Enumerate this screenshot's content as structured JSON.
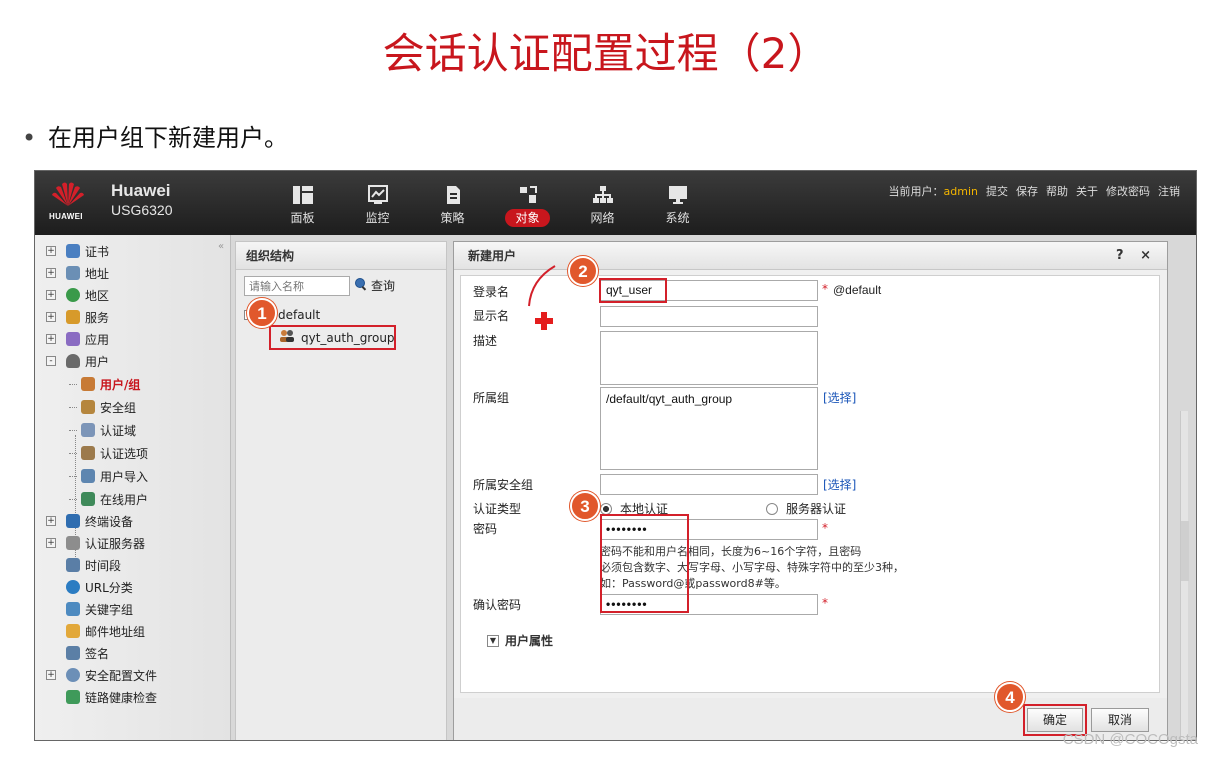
{
  "slide": {
    "title": "会话认证配置过程（2）",
    "bullet": "在用户组下新建用户。"
  },
  "app": {
    "brand_name": "Huawei",
    "model": "USG6320",
    "logo_text": "HUAWEI",
    "nav": [
      {
        "label": "面板",
        "icon": "dashboard-icon"
      },
      {
        "label": "监控",
        "icon": "monitor-chart-icon"
      },
      {
        "label": "策略",
        "icon": "policy-document-icon"
      },
      {
        "label": "对象",
        "icon": "object-icon",
        "active": true
      },
      {
        "label": "网络",
        "icon": "network-topology-icon"
      },
      {
        "label": "系统",
        "icon": "system-monitor-icon"
      }
    ],
    "user_prefix": "当前用户：",
    "user_name": "admin",
    "actions": [
      "提交",
      "保存",
      "帮助",
      "关于",
      "修改密码",
      "注销"
    ]
  },
  "tree": {
    "items": [
      {
        "label": "证书",
        "expander": "+"
      },
      {
        "label": "地址",
        "expander": "+"
      },
      {
        "label": "地区",
        "expander": "+"
      },
      {
        "label": "服务",
        "expander": "+"
      },
      {
        "label": "应用",
        "expander": "+"
      },
      {
        "label": "用户",
        "expander": "-"
      }
    ],
    "user_children": [
      "用户/组",
      "安全组",
      "认证域",
      "认证选项",
      "用户导入",
      "在线用户"
    ],
    "items_after": [
      {
        "label": "终端设备",
        "expander": "+"
      },
      {
        "label": "认证服务器",
        "expander": "+"
      },
      {
        "label": "时间段",
        "expander": ""
      },
      {
        "label": "URL分类",
        "expander": ""
      },
      {
        "label": "关键字组",
        "expander": ""
      },
      {
        "label": "邮件地址组",
        "expander": ""
      },
      {
        "label": "签名",
        "expander": ""
      },
      {
        "label": "安全配置文件",
        "expander": "+"
      },
      {
        "label": "链路健康检查",
        "expander": ""
      }
    ]
  },
  "org_panel": {
    "title": "组织结构",
    "search_placeholder": "请输入名称",
    "search_button": "查询",
    "root": "default",
    "group": "qyt_auth_group"
  },
  "dialog": {
    "title": "新建用户",
    "help": "?",
    "close": "×",
    "fields": {
      "login_label": "登录名",
      "login_value": "qyt_user",
      "domain_suffix": "@default",
      "display_label": "显示名",
      "desc_label": "描述",
      "group_label": "所属组",
      "group_value": "/default/qyt_auth_group",
      "select_link": "[选择]",
      "secgroup_label": "所属安全组",
      "secgroup_link": "[选择]",
      "auth_type_label": "认证类型",
      "auth_local": "本地认证",
      "auth_server": "服务器认证",
      "password_label": "密码",
      "password_value": "••••••••",
      "password_hint_1": "密码不能和用户名相同，长度为6~16个字符，且密码",
      "password_hint_2": "必须包含数字、大写字母、小写字母、特殊字符中的至少3种，",
      "password_hint_3": "如：Password@或password8#等。",
      "confirm_label": "确认密码",
      "confirm_value": "••••••••",
      "required_mark": "*",
      "user_props": "用户属性"
    },
    "ok_button": "确定",
    "cancel_button": "取消"
  },
  "badges": [
    "1",
    "2",
    "3",
    "4"
  ],
  "watermark": "CSDN @COCOgsta",
  "colors": {
    "accent_red": "#c8161d",
    "badge_orange": "#e1582c",
    "highlight_red": "#d3202a",
    "admin_yellow": "#f2b400"
  }
}
